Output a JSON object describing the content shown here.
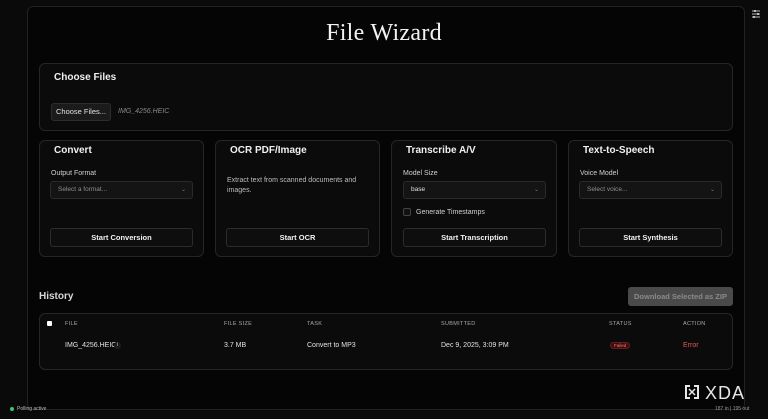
{
  "app": {
    "title": "File Wizard",
    "settings_icon": "settings-sliders-icon"
  },
  "choose_files": {
    "title": "Choose Files",
    "button_label": "Choose Files...",
    "file_name": "IMG_4256.HEIC"
  },
  "convert": {
    "title": "Convert",
    "field_label": "Output Format",
    "select_placeholder": "Select a format...",
    "button_label": "Start Conversion"
  },
  "ocr": {
    "title": "OCR PDF/Image",
    "description": "Extract text from scanned documents and images.",
    "button_label": "Start OCR"
  },
  "transcribe": {
    "title": "Transcribe A/V",
    "field_label": "Model Size",
    "select_value": "base",
    "checkbox_label": "Generate Timestamps",
    "checkbox_checked": false,
    "button_label": "Start Transcription"
  },
  "tts": {
    "title": "Text-to-Speech",
    "field_label": "Voice Model",
    "select_placeholder": "Select voice...",
    "button_label": "Start Synthesis"
  },
  "history": {
    "title": "History",
    "download_button": "Download Selected as ZIP",
    "columns": [
      "FILE",
      "FILE SIZE",
      "TASK",
      "SUBMITTED",
      "STATUS",
      "ACTION"
    ],
    "rows": [
      {
        "file": "IMG_4256.HEIC",
        "info": "i",
        "file_size": "3.7 MB",
        "task": "Convert to MP3",
        "submitted": "Dec 9, 2025, 3:09 PM",
        "status": "Failed",
        "action": "Error"
      }
    ]
  },
  "footer": {
    "polling_text": "Polling active",
    "watermark": "XDA",
    "counts": "187   in | 195   out"
  },
  "colors": {
    "background": "#0a0a0a",
    "failed_badge": "#ff7777",
    "error_link": "#e05a5a",
    "polling_dot": "#2ecc71"
  }
}
